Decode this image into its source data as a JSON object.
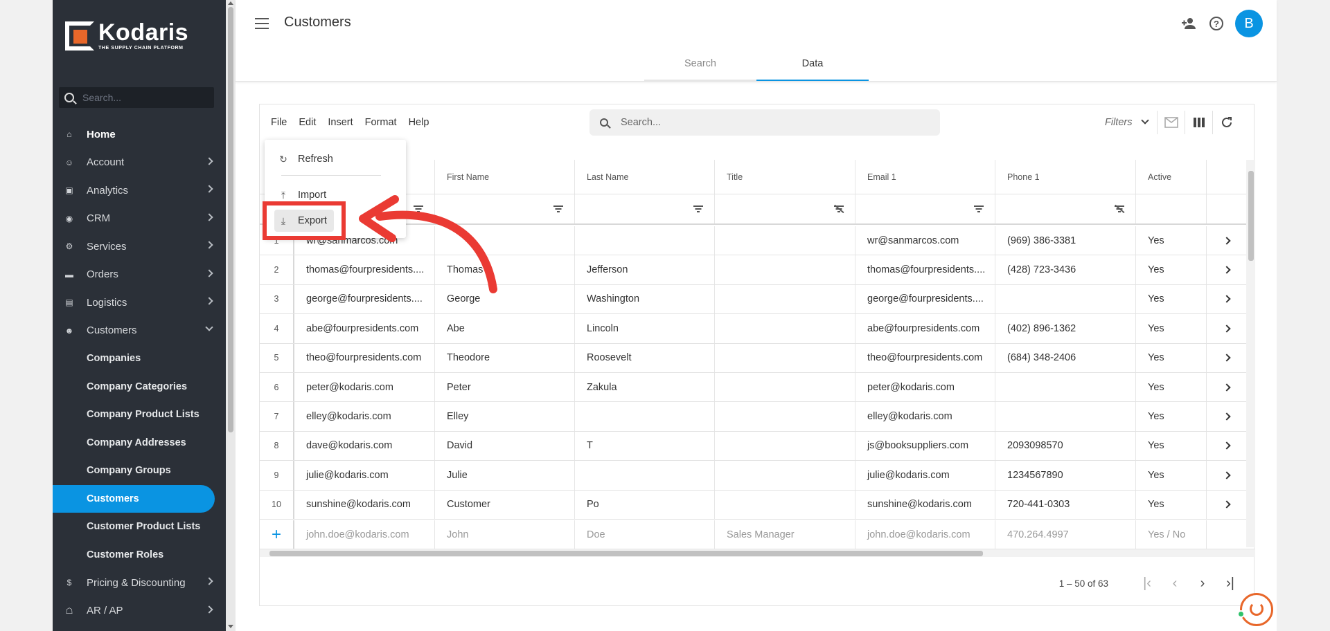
{
  "brand": {
    "name": "Kodaris",
    "tagline": "THE SUPPLY CHAIN PLATFORM",
    "accent": "#0a94e2",
    "logo_orange": "#e8672a"
  },
  "sidebar": {
    "search_placeholder": "Search...",
    "items": [
      {
        "label": "Home",
        "icon": "home-icon",
        "type": "top"
      },
      {
        "label": "Account",
        "icon": "account-icon",
        "type": "expand"
      },
      {
        "label": "Analytics",
        "icon": "analytics-icon",
        "type": "expand"
      },
      {
        "label": "CRM",
        "icon": "crm-icon",
        "type": "expand"
      },
      {
        "label": "Services",
        "icon": "services-icon",
        "type": "expand"
      },
      {
        "label": "Orders",
        "icon": "truck-icon",
        "type": "expand"
      },
      {
        "label": "Logistics",
        "icon": "logistics-icon",
        "type": "expand"
      },
      {
        "label": "Customers",
        "icon": "people-icon",
        "type": "open"
      },
      {
        "label": "Companies",
        "type": "sub"
      },
      {
        "label": "Company Categories",
        "type": "sub"
      },
      {
        "label": "Company Product Lists",
        "type": "sub"
      },
      {
        "label": "Company Addresses",
        "type": "sub"
      },
      {
        "label": "Company Groups",
        "type": "sub"
      },
      {
        "label": "Customers",
        "type": "sub",
        "active": true
      },
      {
        "label": "Customer Product Lists",
        "type": "sub"
      },
      {
        "label": "Customer Roles",
        "type": "sub"
      },
      {
        "label": "Pricing & Discounting",
        "icon": "dollar-icon",
        "type": "expand"
      },
      {
        "label": "AR / AP",
        "icon": "bank-icon",
        "type": "expand"
      }
    ]
  },
  "header": {
    "title": "Customers",
    "avatar_initial": "B"
  },
  "tabs": [
    {
      "label": "Search"
    },
    {
      "label": "Data",
      "active": true
    }
  ],
  "toolbar": {
    "menus": [
      "File",
      "Edit",
      "Insert",
      "Format",
      "Help"
    ],
    "search_placeholder": "Search...",
    "filters_label": "Filters"
  },
  "file_menu": {
    "refresh": "Refresh",
    "import": "Import",
    "export": "Export"
  },
  "table": {
    "columns": [
      "",
      "",
      "First Name",
      "Last Name",
      "Title",
      "Email 1",
      "Phone 1",
      "Active"
    ],
    "rows": [
      {
        "n": "1",
        "login": "wr@sanmarcos.com",
        "first": "",
        "last": "",
        "title": "",
        "email": "wr@sanmarcos.com",
        "phone": "(969) 386-3381",
        "active": "Yes"
      },
      {
        "n": "2",
        "login": "thomas@fourpresidents....",
        "first": "Thomas",
        "last": "Jefferson",
        "title": "",
        "email": "thomas@fourpresidents....",
        "phone": "(428) 723-3436",
        "active": "Yes"
      },
      {
        "n": "3",
        "login": "george@fourpresidents....",
        "first": "George",
        "last": "Washington",
        "title": "",
        "email": "george@fourpresidents....",
        "phone": "",
        "active": "Yes"
      },
      {
        "n": "4",
        "login": "abe@fourpresidents.com",
        "first": "Abe",
        "last": "Lincoln",
        "title": "",
        "email": "abe@fourpresidents.com",
        "phone": "(402) 896-1362",
        "active": "Yes"
      },
      {
        "n": "5",
        "login": "theo@fourpresidents.com",
        "first": "Theodore",
        "last": "Roosevelt",
        "title": "",
        "email": "theo@fourpresidents.com",
        "phone": "(684) 348-2406",
        "active": "Yes"
      },
      {
        "n": "6",
        "login": "peter@kodaris.com",
        "first": "Peter",
        "last": "Zakula",
        "title": "",
        "email": "peter@kodaris.com",
        "phone": "",
        "active": "Yes"
      },
      {
        "n": "7",
        "login": "elley@kodaris.com",
        "first": "Elley",
        "last": "",
        "title": "",
        "email": "elley@kodaris.com",
        "phone": "",
        "active": "Yes"
      },
      {
        "n": "8",
        "login": "dave@kodaris.com",
        "first": "David",
        "last": "T",
        "title": "",
        "email": "js@booksuppliers.com",
        "phone": "2093098570",
        "active": "Yes"
      },
      {
        "n": "9",
        "login": "julie@kodaris.com",
        "first": "Julie",
        "last": "",
        "title": "",
        "email": "julie@kodaris.com",
        "phone": "1234567890",
        "active": "Yes"
      },
      {
        "n": "10",
        "login": "sunshine@kodaris.com",
        "first": "Customer",
        "last": "Po",
        "title": "",
        "email": "sunshine@kodaris.com",
        "phone": "720-441-0303",
        "active": "Yes"
      }
    ],
    "new_row": {
      "login": "john.doe@kodaris.com",
      "first": "John",
      "last": "Doe",
      "title": "Sales Manager",
      "email": "john.doe@kodaris.com",
      "phone": "470.264.4997",
      "active": "Yes / No"
    }
  },
  "pager": {
    "range": "1 – 50 of 63"
  },
  "annotation": {
    "color": "#ea3a33"
  }
}
